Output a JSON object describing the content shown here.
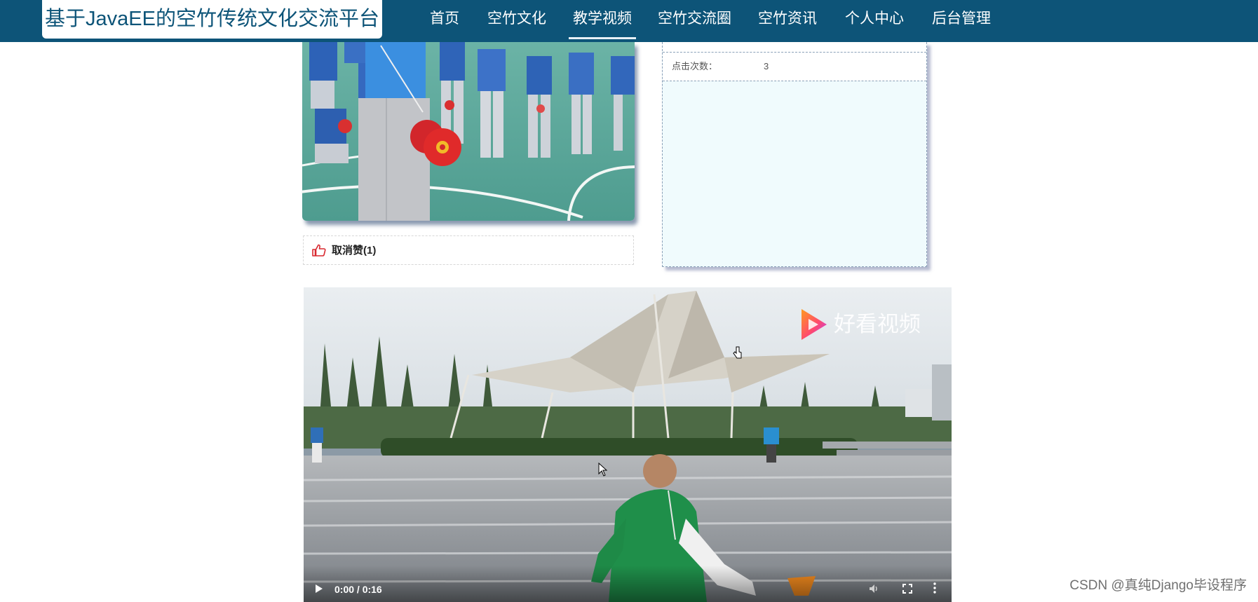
{
  "site": {
    "title": "基于JavaEE的空竹传统文化交流平台"
  },
  "nav": {
    "items": [
      {
        "label": "首页"
      },
      {
        "label": "空竹文化"
      },
      {
        "label": "教学视频"
      },
      {
        "label": "空竹交流圈"
      },
      {
        "label": "空竹资讯"
      },
      {
        "label": "个人中心"
      },
      {
        "label": "后台管理"
      }
    ],
    "active_index": 2
  },
  "detail": {
    "like_label": "取消赞(1)",
    "info_rows": [
      {
        "label": "点击次数：",
        "value": "3"
      }
    ]
  },
  "video": {
    "watermark": "好看视频",
    "time": "0:00 / 0:16"
  },
  "footer": {
    "credit": "CSDN @真纯Django毕设程序"
  },
  "colors": {
    "nav_bg": "#0d5478",
    "panel_bg": "#f0fbfd",
    "like_red": "#d8282f"
  },
  "icons": {
    "like": "thumbs-up-icon",
    "play": "play-icon",
    "volume": "volume-icon",
    "fullscreen": "fullscreen-icon",
    "more": "more-vertical-icon"
  }
}
